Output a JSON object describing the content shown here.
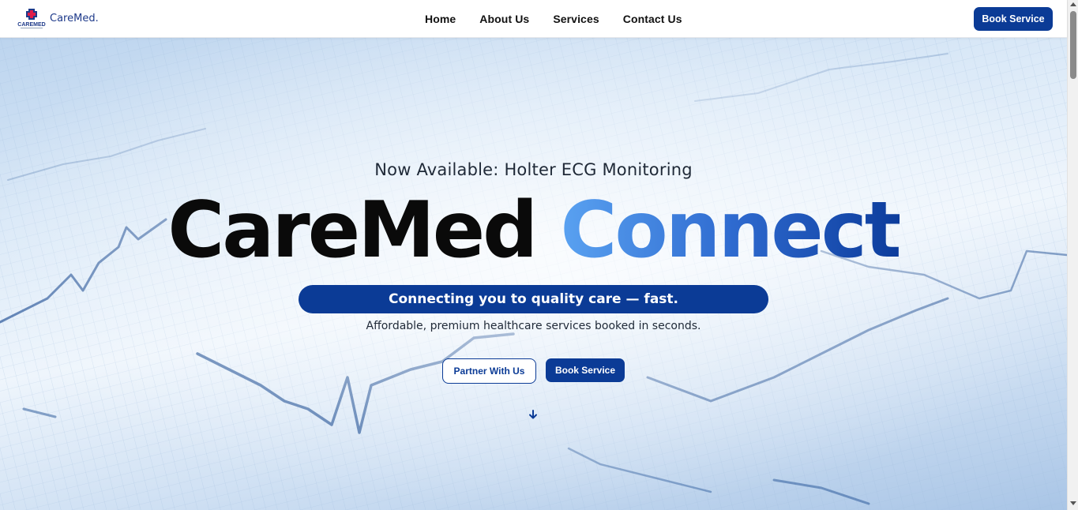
{
  "header": {
    "brand": "CareMed.",
    "logo_label": "CAREMED",
    "nav": [
      "Home",
      "About Us",
      "Services",
      "Contact Us"
    ],
    "cta_label": "Book Service"
  },
  "hero": {
    "eyebrow": "Now Available: Holter ECG Monitoring",
    "title_part1": "CareMed",
    "title_part2": "Connect",
    "tagline": "Connecting you to quality care — fast.",
    "subtext": "Affordable, premium healthcare services booked in seconds.",
    "primary_button": "Book Service",
    "secondary_button": "Partner With Us",
    "scroll_icon": "arrow-down-icon"
  },
  "colors": {
    "brand_blue": "#0b3b96",
    "gradient_light": "#5aa2f1",
    "gradient_dark": "#0c3c9c",
    "text_dark": "#0a0a0a"
  }
}
